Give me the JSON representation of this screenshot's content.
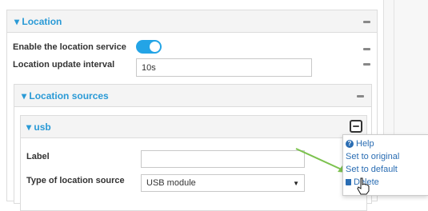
{
  "location": {
    "title": "▾ Location",
    "enable_label": "Enable the location service",
    "enable_on": true,
    "interval_label": "Location update interval",
    "interval_value": "10s"
  },
  "sources": {
    "title": "▾ Location sources"
  },
  "usb": {
    "title": "▾ usb",
    "label_label": "Label",
    "label_value": "",
    "type_label": "Type of location source",
    "type_value": "USB module"
  },
  "menu": {
    "help": "Help",
    "set_original": "Set to original",
    "set_default": "Set to default",
    "delete": "Delete"
  },
  "colors": {
    "accent": "#2a9ad6",
    "toggle": "#23a4e6",
    "arrow": "#7cc24e"
  }
}
